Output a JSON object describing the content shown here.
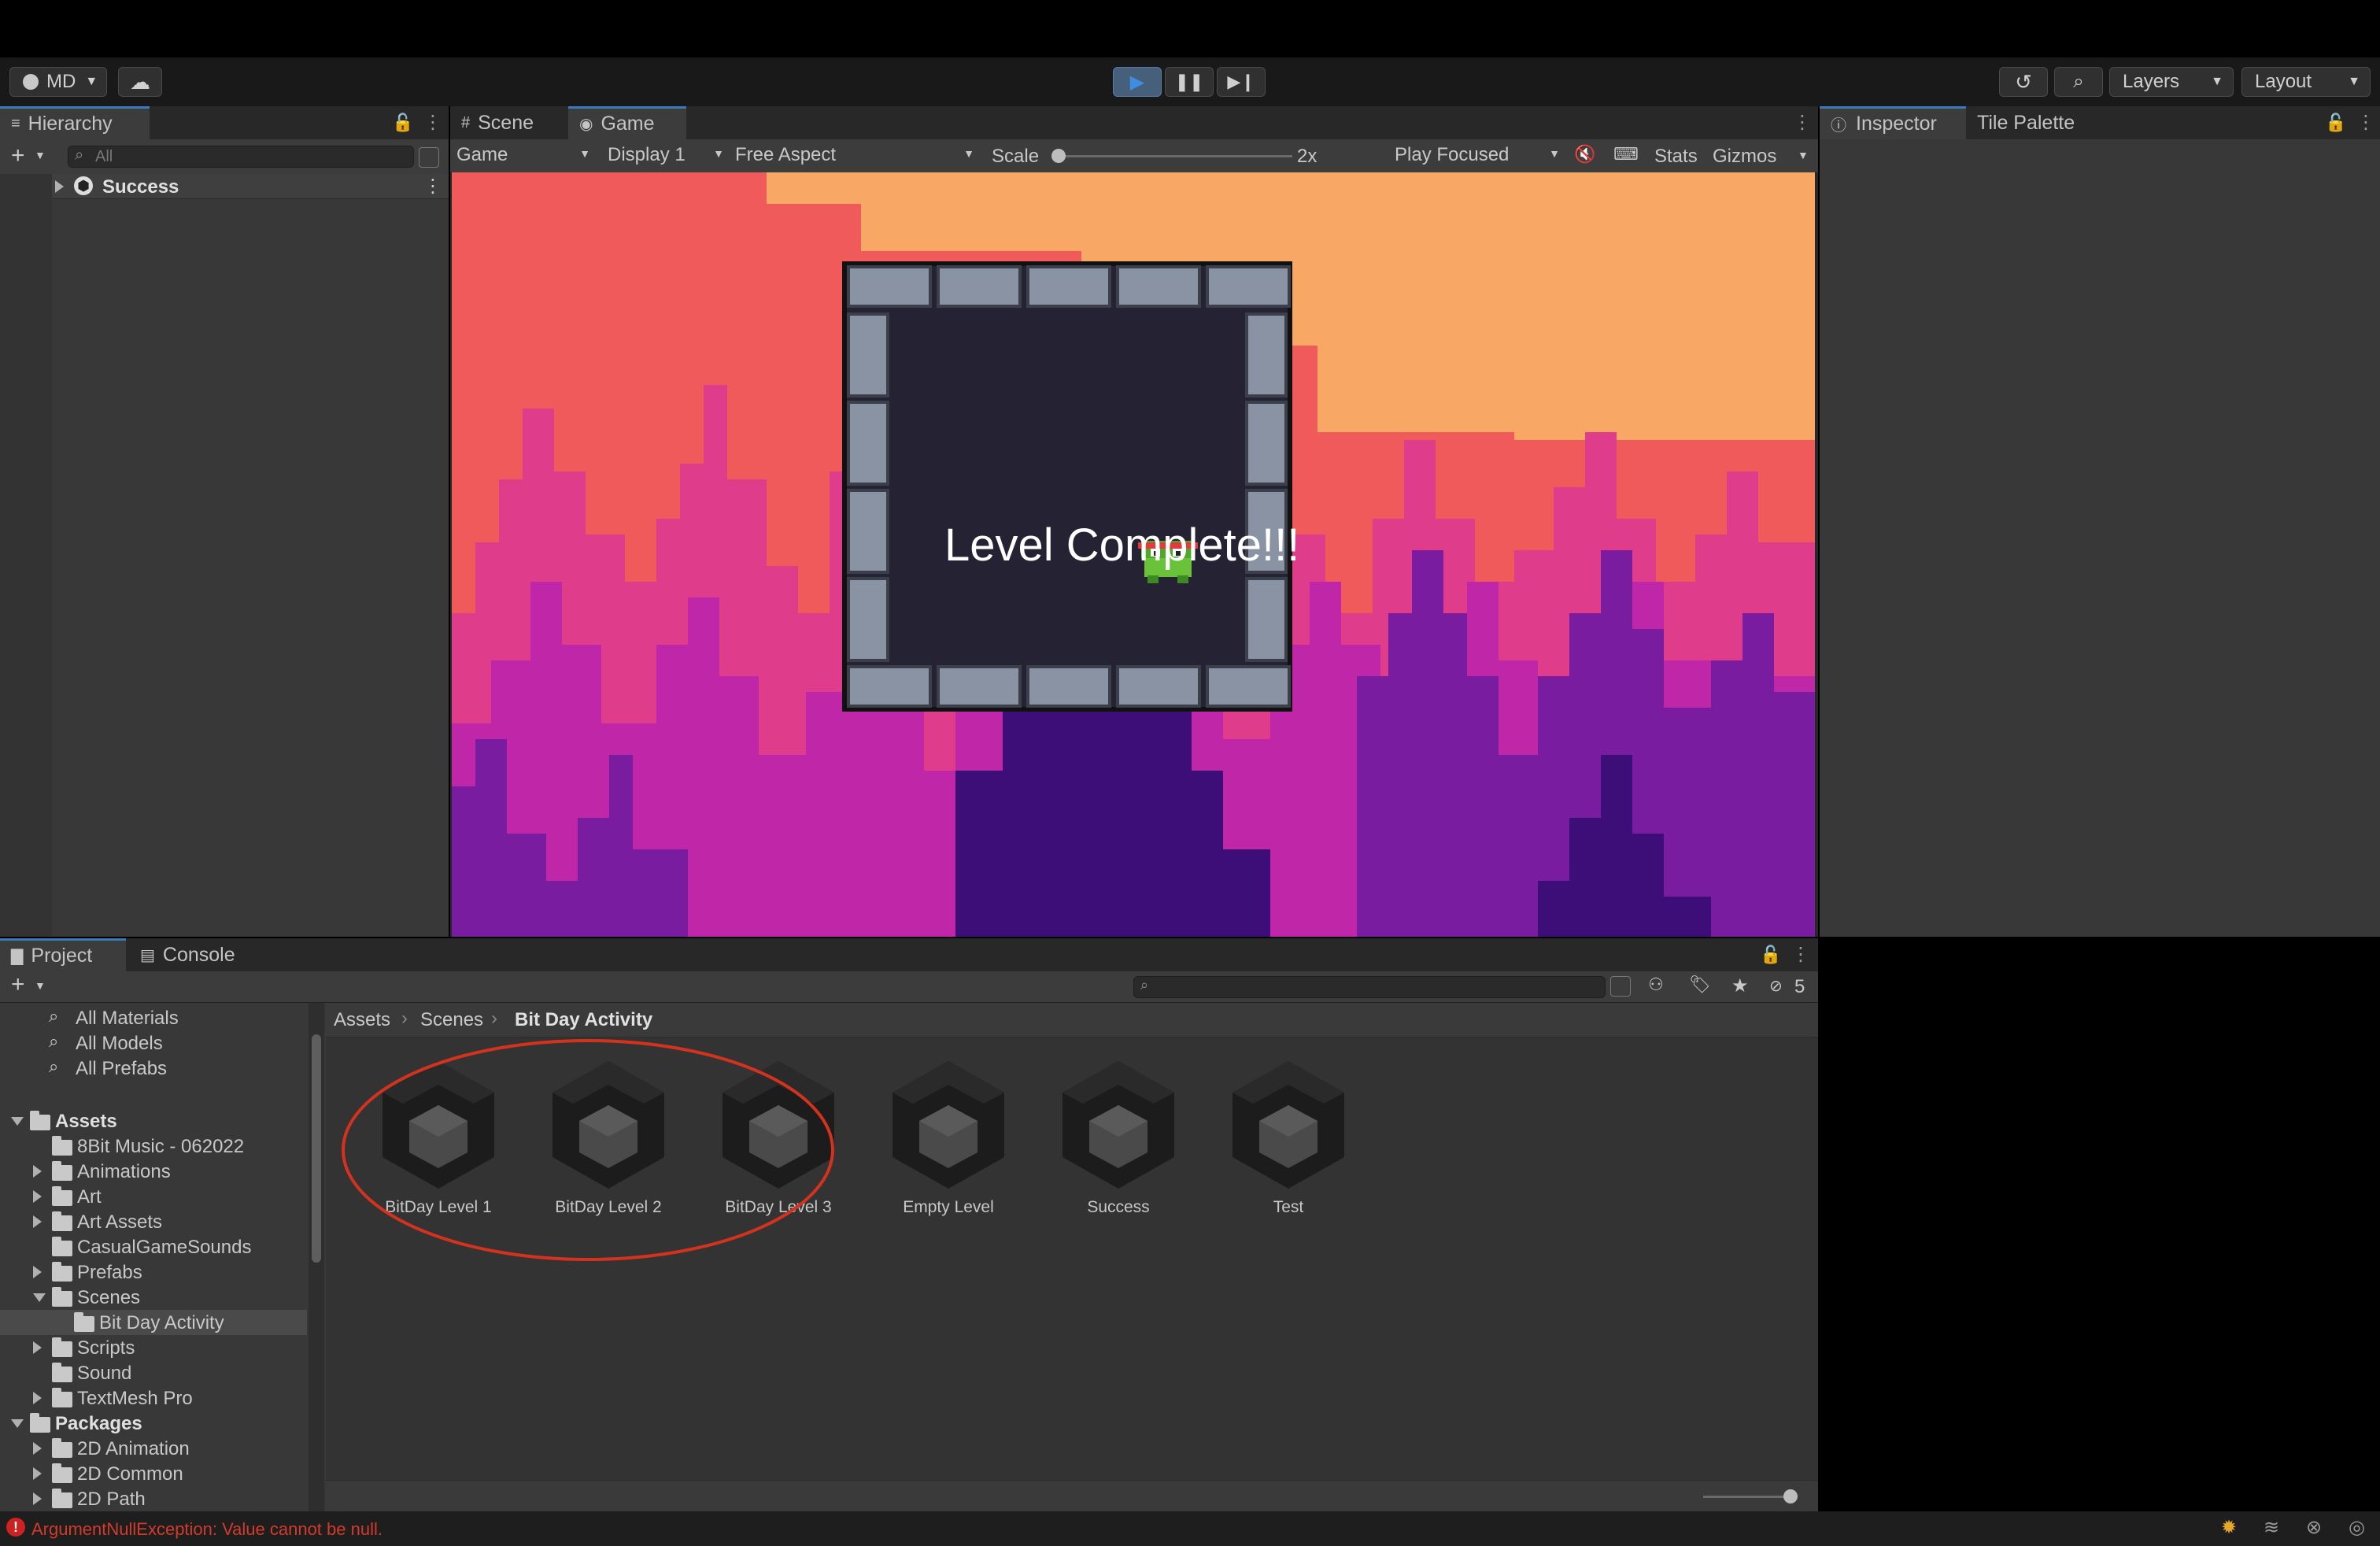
{
  "toolbar": {
    "account_label": "MD",
    "layers_label": "Layers",
    "layout_label": "Layout"
  },
  "hierarchy": {
    "tab_label": "Hierarchy",
    "search_placeholder": "All",
    "root_item": "Success"
  },
  "game_view": {
    "tabs": [
      "Scene",
      "Game"
    ],
    "mode_select": "Game",
    "display_select": "Display 1",
    "aspect_select": "Free Aspect",
    "scale_label": "Scale",
    "scale_value": "2x",
    "play_focused": "Play Focused",
    "stats_label": "Stats",
    "gizmos_label": "Gizmos",
    "game_text": "Level Complete!!!",
    "colors": {
      "sky_top": "#f8a864",
      "sky_mid": "#f05a5a",
      "forest_pink": "#e03c8c",
      "forest_magenta": "#c026a8",
      "forest_purple": "#7a1ca0",
      "forest_dark": "#3e0e78",
      "frame_bg": "#252233",
      "stone": "#8a93a3"
    }
  },
  "inspector": {
    "tabs": [
      "Inspector",
      "Tile Palette"
    ]
  },
  "project": {
    "tabs": [
      "Project",
      "Console"
    ],
    "hidden_count": "5",
    "favorites": [
      "All Materials",
      "All Models",
      "All Prefabs"
    ],
    "tree": [
      {
        "label": "Assets",
        "level": 0,
        "expanded": true,
        "bold": true
      },
      {
        "label": "8Bit Music - 062022",
        "level": 1,
        "has_children": false
      },
      {
        "label": "Animations",
        "level": 1,
        "has_children": true
      },
      {
        "label": "Art",
        "level": 1,
        "has_children": true
      },
      {
        "label": "Art Assets",
        "level": 1,
        "has_children": true
      },
      {
        "label": "CasualGameSounds",
        "level": 1,
        "has_children": false
      },
      {
        "label": "Prefabs",
        "level": 1,
        "has_children": true
      },
      {
        "label": "Scenes",
        "level": 1,
        "expanded": true
      },
      {
        "label": "Bit Day Activity",
        "level": 2,
        "selected": true
      },
      {
        "label": "Scripts",
        "level": 1,
        "has_children": true
      },
      {
        "label": "Sound",
        "level": 1,
        "has_children": false
      },
      {
        "label": "TextMesh Pro",
        "level": 1,
        "has_children": true
      },
      {
        "label": "Packages",
        "level": 0,
        "expanded": true,
        "bold": true
      },
      {
        "label": "2D Animation",
        "level": 1,
        "has_children": true
      },
      {
        "label": "2D Common",
        "level": 1,
        "has_children": true
      },
      {
        "label": "2D Path",
        "level": 1,
        "has_children": true
      }
    ],
    "breadcrumb": [
      "Assets",
      "Scenes",
      "Bit Day Activity"
    ],
    "assets": [
      "BitDay Level 1",
      "BitDay Level 2",
      "BitDay Level 3",
      "Empty Level",
      "Success",
      "Test"
    ]
  },
  "status_bar": {
    "error_text": "ArgumentNullException: Value cannot be null."
  }
}
